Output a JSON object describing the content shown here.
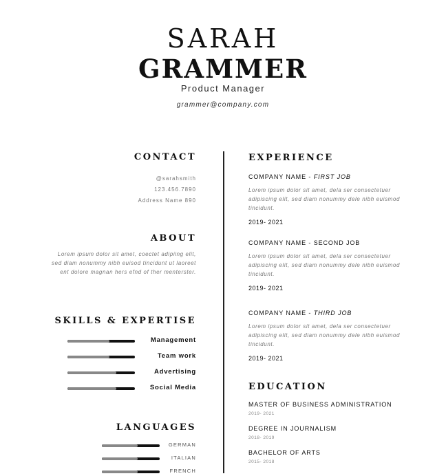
{
  "header": {
    "first_name": "SARAH",
    "last_name": "GRAMMER",
    "job_title": "Product Manager",
    "email": "grammer@company.com"
  },
  "contact": {
    "heading": "CONTACT",
    "handle": "@sarahsmith",
    "phone": "123.456.7890",
    "address": "Address Name 890"
  },
  "about": {
    "heading": "ABOUT",
    "text": "Lorem ipsum dolor sit amet, coectet adipiing elit, sed diam nonummy nibh euisod tincidunt ut laoreet ent dolore magnan hers efnd of ther menterster."
  },
  "skills": {
    "heading": "SKILLS & EXPERTISE",
    "items": [
      {
        "label": "Management",
        "level": 0.62
      },
      {
        "label": "Team work",
        "level": 0.62
      },
      {
        "label": "Advertising",
        "level": 0.72
      },
      {
        "label": "Social Media",
        "level": 0.72
      }
    ]
  },
  "languages": {
    "heading": "LANGUAGES",
    "items": [
      {
        "label": "GERMAN",
        "level": 0.62
      },
      {
        "label": "ITALIAN",
        "level": 0.62
      },
      {
        "label": "FRENCH",
        "level": 0.62
      }
    ]
  },
  "experience": {
    "heading": "EXPERIENCE",
    "jobs": [
      {
        "company": "COMPANY NAME - ",
        "role": "FIRST JOB",
        "desc": "Lorem ipsum dolor sit amet, dela ser consectetuer adipiscing elit, sed diam nonummy dele nibh euismod tincidunt.",
        "dates": "2019- 2021"
      },
      {
        "company": "COMPANY NAME - ",
        "role": "SECOND JOB",
        "desc": "Lorem ipsum dolor sit amet, dela ser consectetuer adipiscing elit, sed diam nonummy dele nibh euismod tincidunt.",
        "dates": "2019- 2021"
      },
      {
        "company": "COMPANY NAME - ",
        "role": "THIRD JOB",
        "desc": "Lorem ipsum dolor sit amet, dela ser consectetuer adipiscing elit, sed diam nonummy dele nibh euismod tincidunt.",
        "dates": "2019- 2021"
      }
    ]
  },
  "education": {
    "heading": "EDUCATION",
    "items": [
      {
        "degree": "MASTER OF BUSINESS ADMINISTRATION",
        "dates": "2019- 2021"
      },
      {
        "degree": "DEGREE IN JOURNALISM",
        "dates": "2018- 2019"
      },
      {
        "degree": "BACHELOR OF ARTS",
        "dates": "2015- 2018"
      }
    ]
  }
}
